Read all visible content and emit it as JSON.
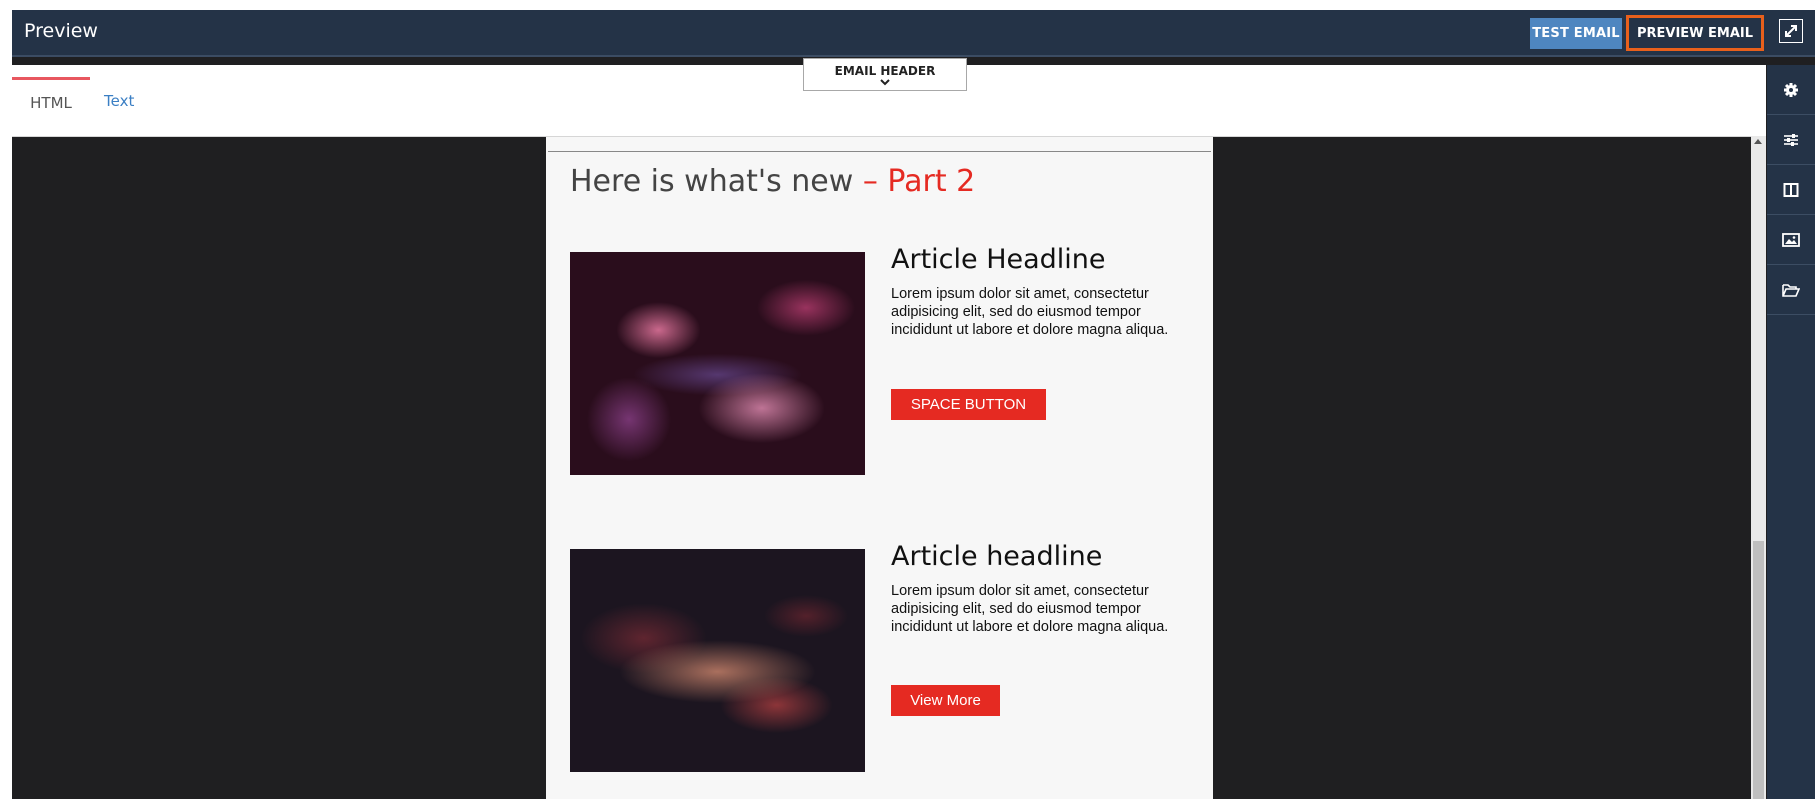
{
  "window": {
    "title": "Preview"
  },
  "toolbar": {
    "test_email_label": "TEST EMAIL",
    "preview_email_label": "PREVIEW EMAIL",
    "expand_icon": "expand-icon",
    "highlight_color": "#e8601c"
  },
  "tabs": [
    {
      "label": "HTML",
      "active": true
    },
    {
      "label": "Text",
      "active": false
    }
  ],
  "email_header_toggle": {
    "label": "EMAIL HEADER",
    "icon": "chevron-down-icon"
  },
  "sidebar": {
    "icons": [
      "gear-icon",
      "sliders-icon",
      "columns-icon",
      "image-icon",
      "folder-open-icon"
    ]
  },
  "email": {
    "heading": "Here is what's new",
    "heading_accent": " – Part 2",
    "accent_color": "#e52a22",
    "articles": [
      {
        "headline": "Article Headline",
        "body": "Lorem ipsum dolor sit amet, consectetur adipisicing elit, sed do eiusmod tempor incididunt ut labore et dolore magna aliqua.",
        "button_label": "SPACE BUTTON",
        "image": "nebula-image"
      },
      {
        "headline": "Article headline",
        "body": "Lorem ipsum dolor sit amet, consectetur adipisicing elit, sed do eiusmod tempor incididunt ut labore et dolore magna aliqua.",
        "button_label": "View More",
        "image": "galaxy-image"
      }
    ]
  }
}
